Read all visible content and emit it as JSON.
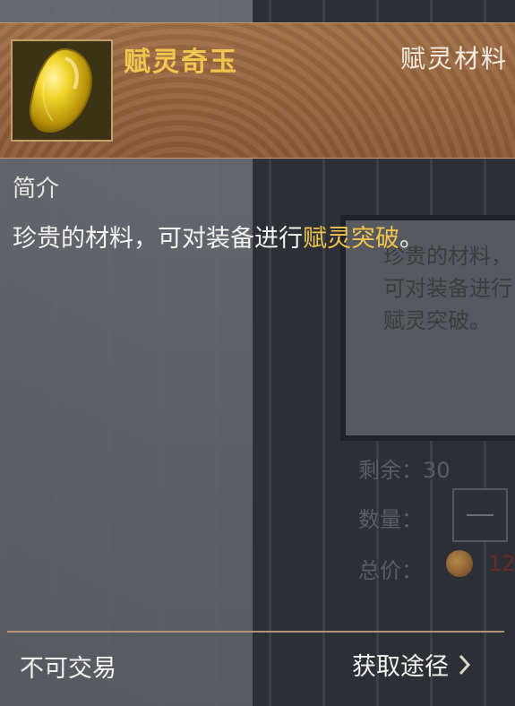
{
  "item": {
    "name": "赋灵奇玉",
    "category": "赋灵材料",
    "icon": "yellow-jade-gem-icon"
  },
  "description": {
    "section_label": "简介",
    "text_before": "珍贵的材料，可对装备进行",
    "text_highlight": "赋灵突破",
    "text_after": "。"
  },
  "footer": {
    "trade_status": "不可交易",
    "source_link": "获取途径",
    "chevron_icon": "chevron-right-icon"
  },
  "background_panel": {
    "text": "珍贵的材料，可对装备进行赋灵突破。",
    "remaining_label": "剩余：30",
    "quantity_label": "数量：",
    "total_price_label": "总价：",
    "price_value": "12"
  },
  "colors": {
    "title": "#f2c54e",
    "highlight": "#f2c54e",
    "header_bg": "#9a6940"
  }
}
